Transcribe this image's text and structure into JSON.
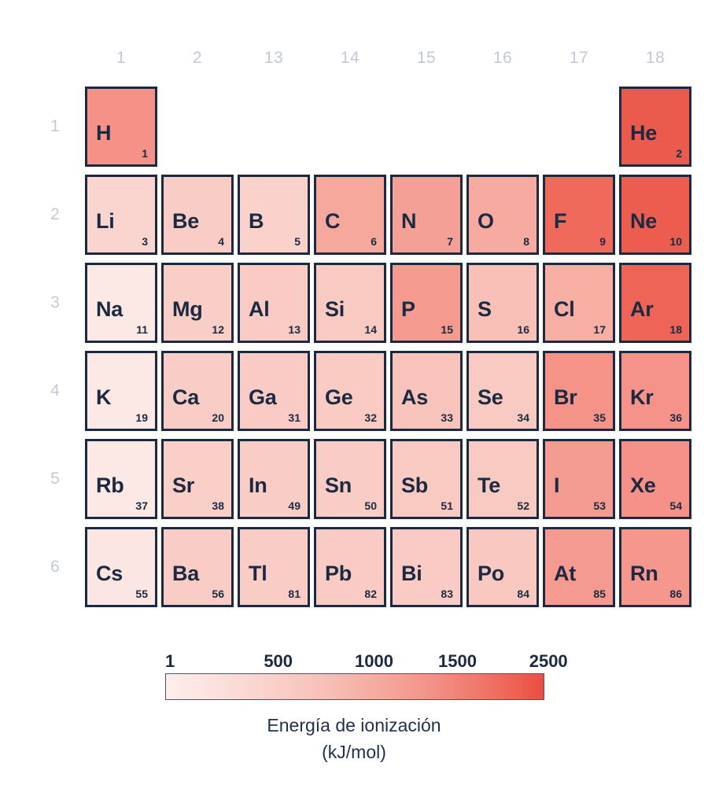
{
  "figure": {
    "type": "periodic-table-heatmap",
    "language": "es"
  },
  "groups": [
    "1",
    "2",
    "13",
    "14",
    "15",
    "16",
    "17",
    "18"
  ],
  "periods": [
    "1",
    "2",
    "3",
    "4",
    "5",
    "6"
  ],
  "colorbar": {
    "ticks": [
      "1",
      "500",
      "1000",
      "1500",
      "2500"
    ],
    "tick_positions_pct": [
      0,
      26,
      50,
      72,
      96
    ],
    "min_color": "#fdeeeb",
    "max_color": "#e94f40",
    "border_color": "#4a5568",
    "caption_line1": "Energía de ionización",
    "caption_line2": "(kJ/mol)"
  },
  "style": {
    "cell_border": "#1b2a41",
    "text_color": "#1b2a41",
    "axis_label_color": "#c3c9d4",
    "background": "#ffffff"
  },
  "chart_data": {
    "type": "heatmap",
    "title": "",
    "value_label": "Energía de ionización",
    "unit": "kJ/mol",
    "xlabel": "",
    "ylabel": "",
    "x_categories": [
      "1",
      "2",
      "13",
      "14",
      "15",
      "16",
      "17",
      "18"
    ],
    "y_categories": [
      "1",
      "2",
      "3",
      "4",
      "5",
      "6"
    ],
    "colorbar_ticks": [
      1,
      500,
      1000,
      1500,
      2500
    ],
    "value_range": [
      1,
      2500
    ],
    "colormap": "white-to-red",
    "legend_position": "bottom",
    "grid": false,
    "cells": [
      [
        {
          "symbol": "H",
          "number": "1",
          "value": 1312,
          "color": "#f59187"
        },
        null,
        null,
        null,
        null,
        null,
        null,
        {
          "symbol": "He",
          "number": "2",
          "value": 2372,
          "color": "#ea5a4d"
        }
      ],
      [
        {
          "symbol": "Li",
          "number": "3",
          "value": 520,
          "color": "#fad5cf"
        },
        {
          "symbol": "Be",
          "number": "4",
          "value": 900,
          "color": "#f9cdc6"
        },
        {
          "symbol": "B",
          "number": "5",
          "value": 801,
          "color": "#fad2cb"
        },
        {
          "symbol": "C",
          "number": "6",
          "value": 1087,
          "color": "#f6a89d"
        },
        {
          "symbol": "N",
          "number": "7",
          "value": 1402,
          "color": "#f5a096"
        },
        {
          "symbol": "O",
          "number": "8",
          "value": 1314,
          "color": "#f6aaa0"
        },
        {
          "symbol": "F",
          "number": "9",
          "value": 1681,
          "color": "#f06a5c"
        },
        {
          "symbol": "Ne",
          "number": "10",
          "value": 2081,
          "color": "#ec5d50"
        }
      ],
      [
        {
          "symbol": "Na",
          "number": "11",
          "value": 496,
          "color": "#fce9e6"
        },
        {
          "symbol": "Mg",
          "number": "12",
          "value": 738,
          "color": "#f9cec7"
        },
        {
          "symbol": "Al",
          "number": "13",
          "value": 578,
          "color": "#f9cbc4"
        },
        {
          "symbol": "Si",
          "number": "14",
          "value": 787,
          "color": "#f9cac2"
        },
        {
          "symbol": "P",
          "number": "15",
          "value": 1012,
          "color": "#f49a8f"
        },
        {
          "symbol": "S",
          "number": "16",
          "value": 1000,
          "color": "#f8c0b7"
        },
        {
          "symbol": "Cl",
          "number": "17",
          "value": 1251,
          "color": "#f7aea3"
        },
        {
          "symbol": "Ar",
          "number": "18",
          "value": 1521,
          "color": "#ee6456"
        }
      ],
      [
        {
          "symbol": "K",
          "number": "19",
          "value": 419,
          "color": "#fce9e6"
        },
        {
          "symbol": "Ca",
          "number": "20",
          "value": 590,
          "color": "#f9cdc6"
        },
        {
          "symbol": "Ga",
          "number": "31",
          "value": 579,
          "color": "#f9cbc4"
        },
        {
          "symbol": "Ge",
          "number": "32",
          "value": 762,
          "color": "#f9cbc3"
        },
        {
          "symbol": "As",
          "number": "33",
          "value": 947,
          "color": "#f8c3ba"
        },
        {
          "symbol": "Se",
          "number": "34",
          "value": 941,
          "color": "#f9cac2"
        },
        {
          "symbol": "Br",
          "number": "35",
          "value": 1140,
          "color": "#f59389"
        },
        {
          "symbol": "Kr",
          "number": "36",
          "value": 1351,
          "color": "#f59289"
        }
      ],
      [
        {
          "symbol": "Rb",
          "number": "37",
          "value": 403,
          "color": "#fce9e6"
        },
        {
          "symbol": "Sr",
          "number": "38",
          "value": 549,
          "color": "#f9cfc8"
        },
        {
          "symbol": "In",
          "number": "49",
          "value": 558,
          "color": "#f9cdc6"
        },
        {
          "symbol": "Sn",
          "number": "50",
          "value": 709,
          "color": "#f9ccc5"
        },
        {
          "symbol": "Sb",
          "number": "51",
          "value": 834,
          "color": "#f9cac2"
        },
        {
          "symbol": "Te",
          "number": "52",
          "value": 869,
          "color": "#f9cac2"
        },
        {
          "symbol": "I",
          "number": "53",
          "value": 1008,
          "color": "#f59c92"
        },
        {
          "symbol": "Xe",
          "number": "54",
          "value": 1170,
          "color": "#f59189"
        }
      ],
      [
        {
          "symbol": "Cs",
          "number": "55",
          "value": 376,
          "color": "#fce6e3"
        },
        {
          "symbol": "Ba",
          "number": "56",
          "value": 503,
          "color": "#f9cdc6"
        },
        {
          "symbol": "Tl",
          "number": "81",
          "value": 589,
          "color": "#f9cdc6"
        },
        {
          "symbol": "Pb",
          "number": "82",
          "value": 716,
          "color": "#f9cbc4"
        },
        {
          "symbol": "Bi",
          "number": "83",
          "value": 703,
          "color": "#f9cbc4"
        },
        {
          "symbol": "Po",
          "number": "84",
          "value": 812,
          "color": "#f9c9c1"
        },
        {
          "symbol": "At",
          "number": "85",
          "value": 920,
          "color": "#f59a90"
        },
        {
          "symbol": "Rn",
          "number": "86",
          "value": 1037,
          "color": "#f5978d"
        }
      ]
    ]
  }
}
